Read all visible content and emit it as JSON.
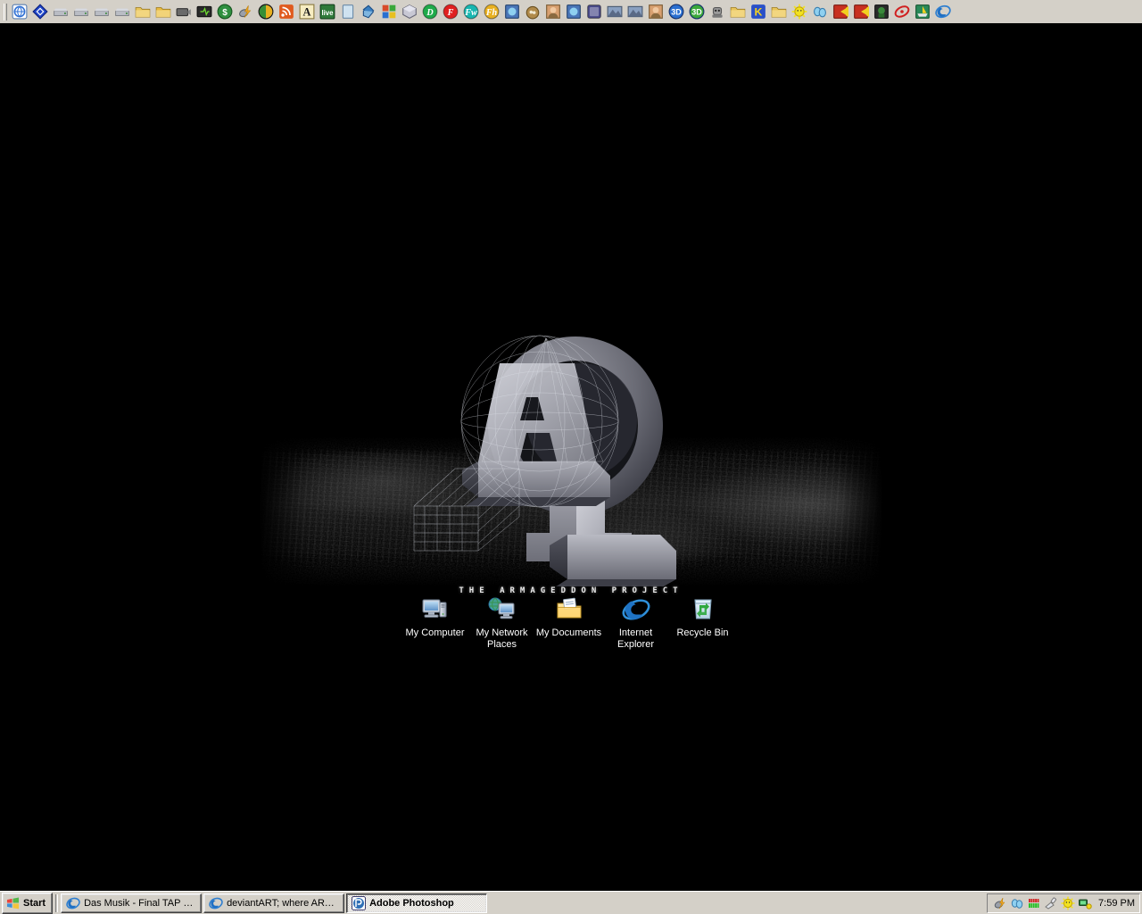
{
  "os": {
    "theme": "windows-classic",
    "desktop_background_color": "#000000",
    "toolbar_background_color": "#d4d0c8"
  },
  "top_toolbar": {
    "name": "quick-launch-toolbar",
    "icons": [
      {
        "name": "internet-shortcut-icon",
        "label": "Internet Shortcut",
        "color": "#2d6fd4"
      },
      {
        "name": "diamond-blue-icon",
        "label": "Blue Diamond",
        "color": "#1f46c8"
      },
      {
        "name": "hard-drive-h-icon",
        "label": "Drive H",
        "color": "#8a8a9a"
      },
      {
        "name": "network-drive-icon",
        "label": "Network Drive",
        "color": "#9aa0aa"
      },
      {
        "name": "network-drive-2-icon",
        "label": "Network Drive 2",
        "color": "#9aa0aa"
      },
      {
        "name": "cd-drive-icon",
        "label": "CD Drive",
        "color": "#a8b0bb"
      },
      {
        "name": "printer-folder-icon",
        "label": "Printers",
        "color": "#e8c45a"
      },
      {
        "name": "open-folder-icon",
        "label": "Open Folder",
        "color": "#e8b93f"
      },
      {
        "name": "video-capture-icon",
        "label": "Video Capture",
        "color": "#7d7d7d"
      },
      {
        "name": "winamp-icon",
        "label": "Winamp",
        "color": "#d9a02b"
      },
      {
        "name": "money-icon",
        "label": "Money",
        "color": "#2f8f3f"
      },
      {
        "name": "lightning-icon",
        "label": "Lightning",
        "color": "#e8a020"
      },
      {
        "name": "color-sphere-icon",
        "label": "Color Sphere",
        "color": "#2a2a2a"
      },
      {
        "name": "rss-feed-icon",
        "label": "RSS Feed",
        "color": "#e05a1e"
      },
      {
        "name": "font-a-icon",
        "label": "Fonts",
        "color": "#f0e0a0"
      },
      {
        "name": "live-green-icon",
        "label": "Live",
        "color": "#2f7a3a"
      },
      {
        "name": "notepad-icon",
        "label": "Notepad",
        "color": "#b8cfe0"
      },
      {
        "name": "paint-bucket-icon",
        "label": "Paint Bucket",
        "color": "#3a7fc1"
      },
      {
        "name": "windows-tiles-icon",
        "label": "Windows Tiles",
        "color": "#d84b2a"
      },
      {
        "name": "dice-cube-icon",
        "label": "Dice Cube",
        "color": "#c8c8d4"
      },
      {
        "name": "macromedia-dreamweaver-icon",
        "label": "Dreamweaver",
        "color": "#1faa4a"
      },
      {
        "name": "macromedia-flash-icon",
        "label": "Flash",
        "color": "#e02020"
      },
      {
        "name": "macromedia-fireworks-icon",
        "label": "Fireworks",
        "color": "#17b6b0"
      },
      {
        "name": "macromedia-freehand-icon",
        "label": "FreeHand",
        "color": "#e8b020"
      },
      {
        "name": "photo-globe-icon",
        "label": "Photo Globe",
        "color": "#2f6fb5"
      },
      {
        "name": "nest-icon",
        "label": "Nest",
        "color": "#b08a4a"
      },
      {
        "name": "face-icon",
        "label": "Face",
        "color": "#d8a070"
      },
      {
        "name": "photo-editor-icon",
        "label": "Photo Editor",
        "color": "#4a76b8"
      },
      {
        "name": "milkshape-icon",
        "label": "MilkShape 3D",
        "color": "#4a4a8a"
      },
      {
        "name": "mountain-icon",
        "label": "Terrain",
        "color": "#6a7a9a"
      },
      {
        "name": "mountain-2-icon",
        "label": "Terrain 2",
        "color": "#6a7a9a"
      },
      {
        "name": "portrait-photo-icon",
        "label": "Portrait",
        "color": "#c08050"
      },
      {
        "name": "3d-blue-icon",
        "label": "3D Blue",
        "color": "#2a6fd0"
      },
      {
        "name": "3d-green-icon",
        "label": "3D Green",
        "color": "#3aa83a"
      },
      {
        "name": "robot-icon",
        "label": "Robot",
        "color": "#9a9a9a"
      },
      {
        "name": "folder-icon",
        "label": "Folder",
        "color": "#e8c45a"
      },
      {
        "name": "kazaa-icon",
        "label": "Kazaa",
        "color": "#2a50c8"
      },
      {
        "name": "folder-green-icon",
        "label": "Folder Green",
        "color": "#e8c45a"
      },
      {
        "name": "smiley-icon",
        "label": "Smiley",
        "color": "#e8d020"
      },
      {
        "name": "mouse-icon",
        "label": "Mouse",
        "color": "#6aa8d8"
      },
      {
        "name": "red-app-icon",
        "label": "Red App",
        "color": "#c83020"
      },
      {
        "name": "pacman-icon",
        "label": "Pac-Man",
        "color": "#d82020"
      },
      {
        "name": "green-character-icon",
        "label": "Green Character",
        "color": "#3a8a3a"
      },
      {
        "name": "red-swirl-icon",
        "label": "Red Swirl",
        "color": "#d02020"
      },
      {
        "name": "boat-icon",
        "label": "Boat",
        "color": "#2a8a5a"
      },
      {
        "name": "internet-explorer-icon",
        "label": "Internet Explorer",
        "color": "#2f7fd0"
      }
    ]
  },
  "wallpaper": {
    "name": "armageddon-project-wallpaper",
    "tagline": "THE ARMAGEDDON PROJECT",
    "logo_description": "3D Alpha and Omega monument with wireframe overlay",
    "logo_colors": {
      "light": "#c9cad2",
      "mid": "#8f9099",
      "dark": "#4a4b55",
      "shadow": "#2a2b33",
      "wireframe": "#dfe2ea"
    }
  },
  "desktop_icons": [
    {
      "name": "my-computer",
      "label": "My Computer",
      "icon": "computer-icon"
    },
    {
      "name": "my-network-places",
      "label": "My Network Places",
      "icon": "network-places-icon"
    },
    {
      "name": "my-documents",
      "label": "My Documents",
      "icon": "documents-folder-icon"
    },
    {
      "name": "internet-explorer",
      "label": "Internet Explorer",
      "icon": "internet-explorer-icon"
    },
    {
      "name": "recycle-bin",
      "label": "Recycle Bin",
      "icon": "recycle-bin-icon"
    }
  ],
  "taskbar": {
    "start_label": "Start",
    "buttons": [
      {
        "name": "taskbar-button-das-musik",
        "label": "Das Musik - Final TAP Lo...",
        "icon": "internet-explorer-icon",
        "active": false
      },
      {
        "name": "taskbar-button-deviantart",
        "label": "deviantART; where ART ...",
        "icon": "internet-explorer-icon",
        "active": false
      },
      {
        "name": "taskbar-button-photoshop",
        "label": "Adobe Photoshop",
        "icon": "photoshop-icon",
        "active": true
      }
    ],
    "tray": {
      "icons": [
        {
          "name": "tray-lightning-icon",
          "label": "Lightning",
          "color": "#e8a020"
        },
        {
          "name": "tray-mouse-icon",
          "label": "Mouse Settings",
          "color": "#6aa8d8"
        },
        {
          "name": "tray-cpu-meter-icon",
          "label": "CPU Meter",
          "color": "#20c020"
        },
        {
          "name": "tray-plug-icon",
          "label": "Safely Remove Hardware",
          "color": "#c8c8c8"
        },
        {
          "name": "tray-sun-icon",
          "label": "Display Settings",
          "color": "#e8e020"
        },
        {
          "name": "tray-network-icon",
          "label": "Network Connection",
          "color": "#2f8f3f"
        }
      ],
      "clock": "7:59 PM"
    }
  }
}
